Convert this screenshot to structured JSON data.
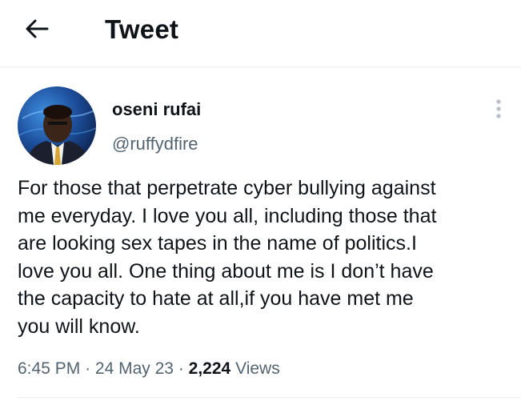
{
  "header": {
    "title": "Tweet",
    "back_icon": "arrow-left-icon"
  },
  "tweet": {
    "author": {
      "display_name": "oseni rufai",
      "handle": "@ruffydfire"
    },
    "more_icon": "vertical-ellipsis-icon",
    "text": "For those that perpetrate cyber bullying against\nme everyday. I love you all, including those that\nare looking sex tapes in the name of politics.I\nlove you all. One thing about me is I don’t have\nthe capacity to hate at all,if you have met me\nyou will know.",
    "time": "6:45 PM",
    "separator": "·",
    "date": "24 May 23",
    "views_count": "2,224",
    "views_label": "Views"
  },
  "colors": {
    "text_primary": "#0f1419",
    "text_secondary": "#536471",
    "divider": "#eceef0"
  }
}
